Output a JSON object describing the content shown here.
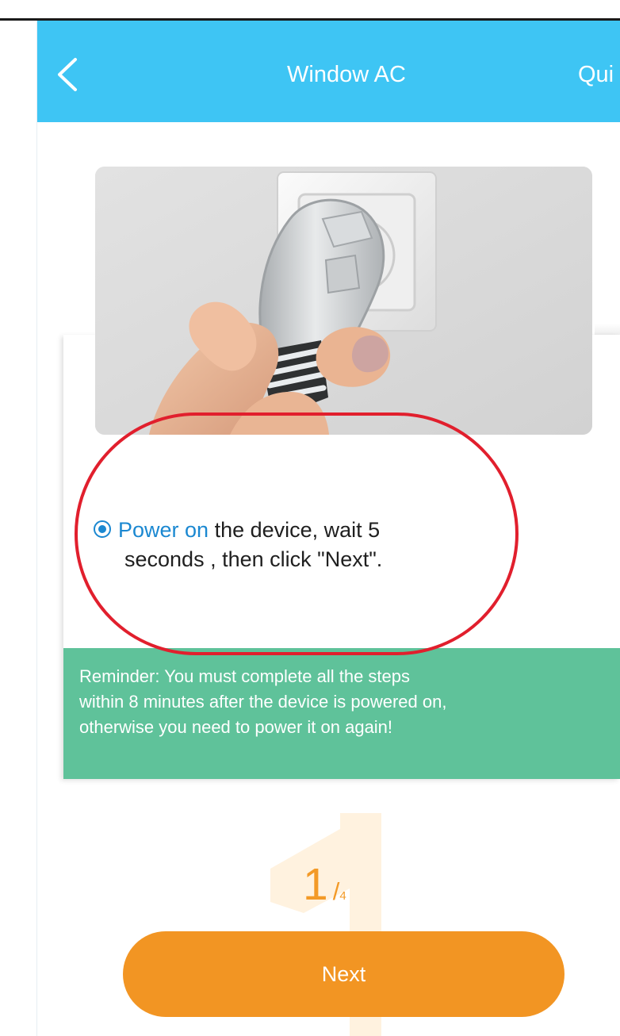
{
  "header": {
    "title": "Window AC",
    "action": "Qui",
    "back_icon": "chevron-left-icon"
  },
  "illustration": {
    "subject": "hand plugging a power plug into a wall outlet",
    "icon": "power-plug-illustration"
  },
  "instruction": {
    "icon": "radio-selected-icon",
    "highlight": "Power on",
    "line_1_rest": " the device, wait 5",
    "line_2": "seconds , then click \"Next\"."
  },
  "reminder": {
    "line_1": "Reminder: You must complete all the steps",
    "line_2": "within 8 minutes after the device is powered on,",
    "line_3": "otherwise you need to power it on again!"
  },
  "step": {
    "current": "1",
    "separator": "/",
    "total": "4"
  },
  "next_button": {
    "label": "Next"
  },
  "colors": {
    "header": "#3ec5f4",
    "reminder": "#5fc29a",
    "button": "#f29523",
    "step_text": "#f39a27",
    "highlight": "#1b88d1",
    "annotation": "#e11f2d"
  }
}
